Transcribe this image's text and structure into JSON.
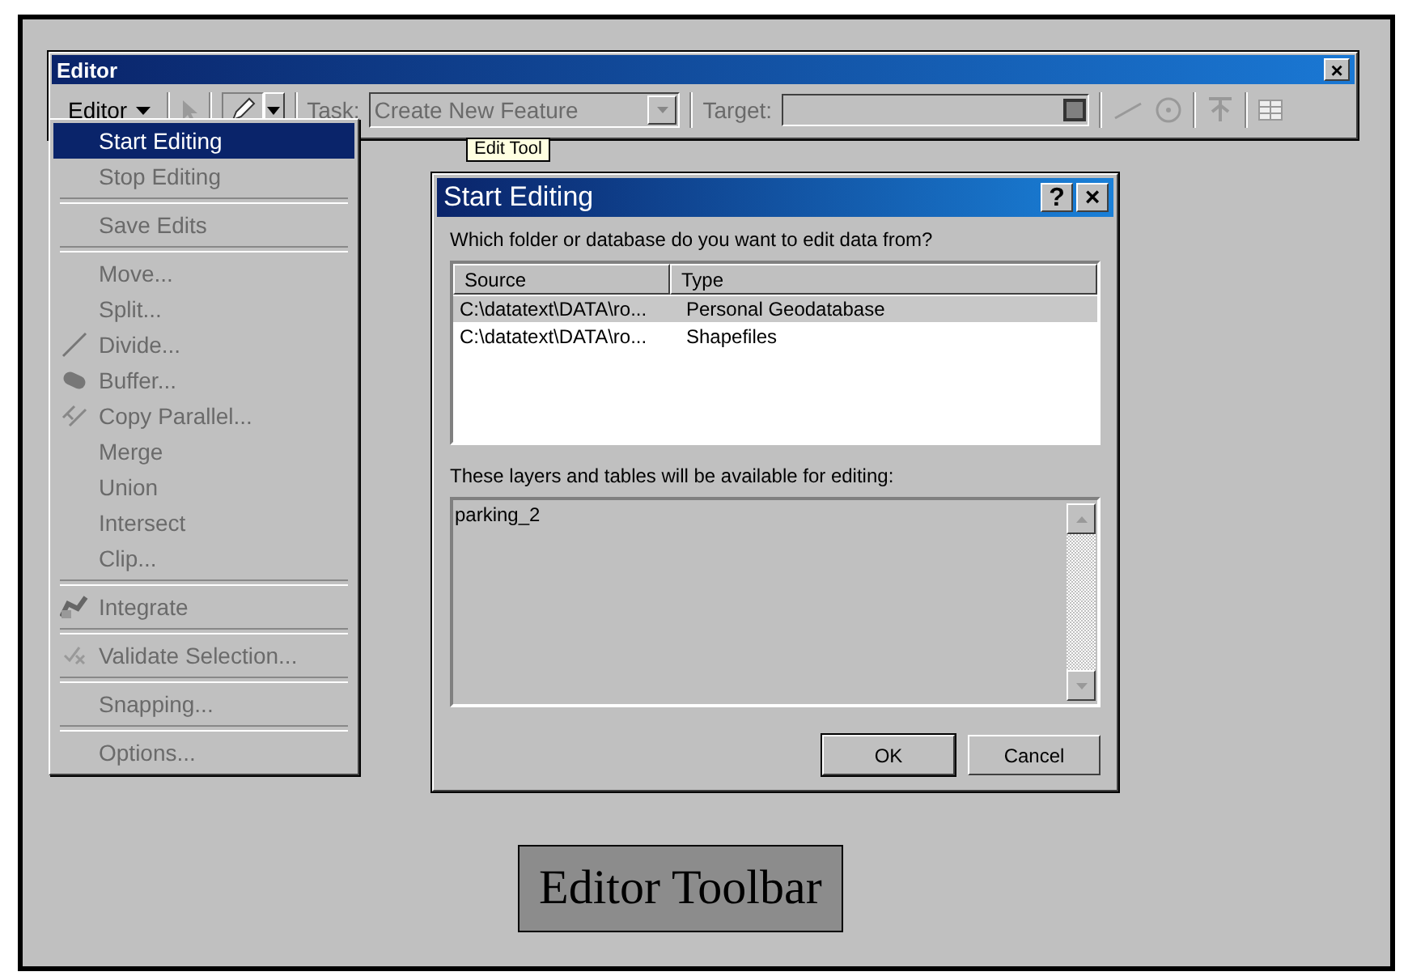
{
  "window": {
    "title": "Editor",
    "close": "×"
  },
  "toolbar": {
    "menu_label": "Editor",
    "disabled": true,
    "task_label": "Task:",
    "task_value": "Create New Feature",
    "target_label": "Target:",
    "tooltip": "Edit Tool"
  },
  "menu": {
    "items": [
      {
        "kind": "command",
        "label": "Start Editing",
        "selected": true,
        "disabled": false
      },
      {
        "kind": "command",
        "label": "Stop Editing",
        "selected": false,
        "disabled": true
      },
      {
        "kind": "separator"
      },
      {
        "kind": "command",
        "label": "Save Edits",
        "selected": false,
        "disabled": true
      },
      {
        "kind": "separator"
      },
      {
        "kind": "command",
        "label": "Move...",
        "selected": false,
        "disabled": true
      },
      {
        "kind": "command",
        "label": "Split...",
        "selected": false,
        "disabled": true
      },
      {
        "kind": "command",
        "label": "Divide...",
        "selected": false,
        "disabled": true
      },
      {
        "kind": "command",
        "label": "Buffer...",
        "selected": false,
        "disabled": true
      },
      {
        "kind": "command",
        "label": "Copy Parallel...",
        "selected": false,
        "disabled": true
      },
      {
        "kind": "command",
        "label": "Merge",
        "selected": false,
        "disabled": true
      },
      {
        "kind": "command",
        "label": "Union",
        "selected": false,
        "disabled": true
      },
      {
        "kind": "command",
        "label": "Intersect",
        "selected": false,
        "disabled": true
      },
      {
        "kind": "command",
        "label": "Clip...",
        "selected": false,
        "disabled": true
      },
      {
        "kind": "separator"
      },
      {
        "kind": "command",
        "label": "Integrate",
        "selected": false,
        "disabled": true
      },
      {
        "kind": "separator"
      },
      {
        "kind": "command",
        "label": "Validate Selection...",
        "selected": false,
        "disabled": true
      },
      {
        "kind": "separator"
      },
      {
        "kind": "command",
        "label": "Snapping...",
        "selected": false,
        "disabled": true
      },
      {
        "kind": "separator"
      },
      {
        "kind": "command",
        "label": "Options...",
        "selected": false,
        "disabled": true
      }
    ]
  },
  "dialog": {
    "title": "Start Editing",
    "help": "?",
    "close": "×",
    "prompt": "Which folder or database do you want to edit data from?",
    "columns": [
      "Source",
      "Type"
    ],
    "rows": [
      {
        "source": "C:\\datatext\\DATA\\ro...",
        "type": "Personal Geodatabase",
        "selected": true
      },
      {
        "source": "C:\\datatext\\DATA\\ro...",
        "type": "Shapefiles",
        "selected": false
      }
    ],
    "layers_label": "These layers and tables will be available for editing:",
    "layers": [
      "parking_2"
    ],
    "buttons": [
      {
        "label": "OK",
        "default": true
      },
      {
        "label": "Cancel",
        "default": false
      }
    ]
  },
  "caption": "Editor Toolbar"
}
